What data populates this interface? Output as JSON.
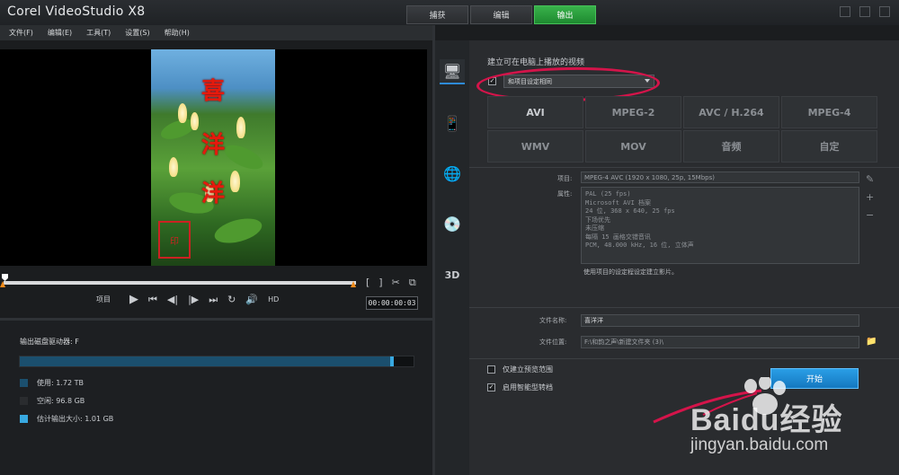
{
  "app": {
    "title": "Corel VideoStudio X8"
  },
  "tabs": [
    {
      "label": "捕获"
    },
    {
      "label": "编辑"
    },
    {
      "label": "输出"
    }
  ],
  "menu": [
    {
      "label": "文件(F)"
    },
    {
      "label": "编辑(E)"
    },
    {
      "label": "工具(T)"
    },
    {
      "label": "设置(S)"
    },
    {
      "label": "帮助(H)"
    }
  ],
  "preview": {
    "overlay_text": [
      "喜",
      "洋",
      "洋"
    ],
    "seal_text": "印"
  },
  "scrubber": {
    "position": 0
  },
  "transport": {
    "project_label": "项目",
    "hd_label": "HD",
    "timecode": "00:00:00:03"
  },
  "disk": {
    "title": "输出磁盘驱动器: F",
    "usage_fraction": 0.95,
    "legend": [
      {
        "label": "使用: 1.72 TB",
        "color": "#1b4f6e"
      },
      {
        "label": "空闲: 96.8 GB",
        "color": "#2a2c2f"
      },
      {
        "label": "估计输出大小: 1.01 GB",
        "color": "#38a8e0"
      }
    ]
  },
  "sidebar_icons": [
    "computer-icon",
    "device-icon",
    "web-icon",
    "disc-icon",
    "3d-icon"
  ],
  "output": {
    "section_title": "建立可在电脑上播放的视频",
    "profile_checked": true,
    "profile_value": "和项目设定相同",
    "formats_row1": [
      "AVI",
      "MPEG-2",
      "AVC / H.264",
      "MPEG-4"
    ],
    "formats_row2": [
      "WMV",
      "MOV",
      "音频",
      "自定"
    ],
    "project_label": "项目:",
    "project_value": "MPEG-4 AVC (1920 x 1080, 25p, 15Mbps)",
    "props_label": "属性:",
    "props_lines": [
      "PAL (25 fps)",
      "Microsoft AVI 档案",
      "24 位, 368 x 640, 25 fps",
      "下场优先",
      "未压缩",
      "每隔 15 画格交错音讯",
      "PCM, 48.000 kHz, 16 位, 立体声"
    ],
    "note": "使用项目的设定程设定建立影片。",
    "filename_label": "文件名称:",
    "filename_value": "喜洋洋",
    "location_label": "文件位置:",
    "location_value": "F:\\和韵之声\\新建文件夹 (3)\\",
    "option_preview_range": "仅建立预览范围",
    "option_preview_checked": false,
    "option_smart_render": "启用智能型转档",
    "option_smart_checked": true,
    "start_label": "开始"
  },
  "watermark": {
    "brand": "Baidu经验",
    "url": "jingyan.baidu.com"
  }
}
